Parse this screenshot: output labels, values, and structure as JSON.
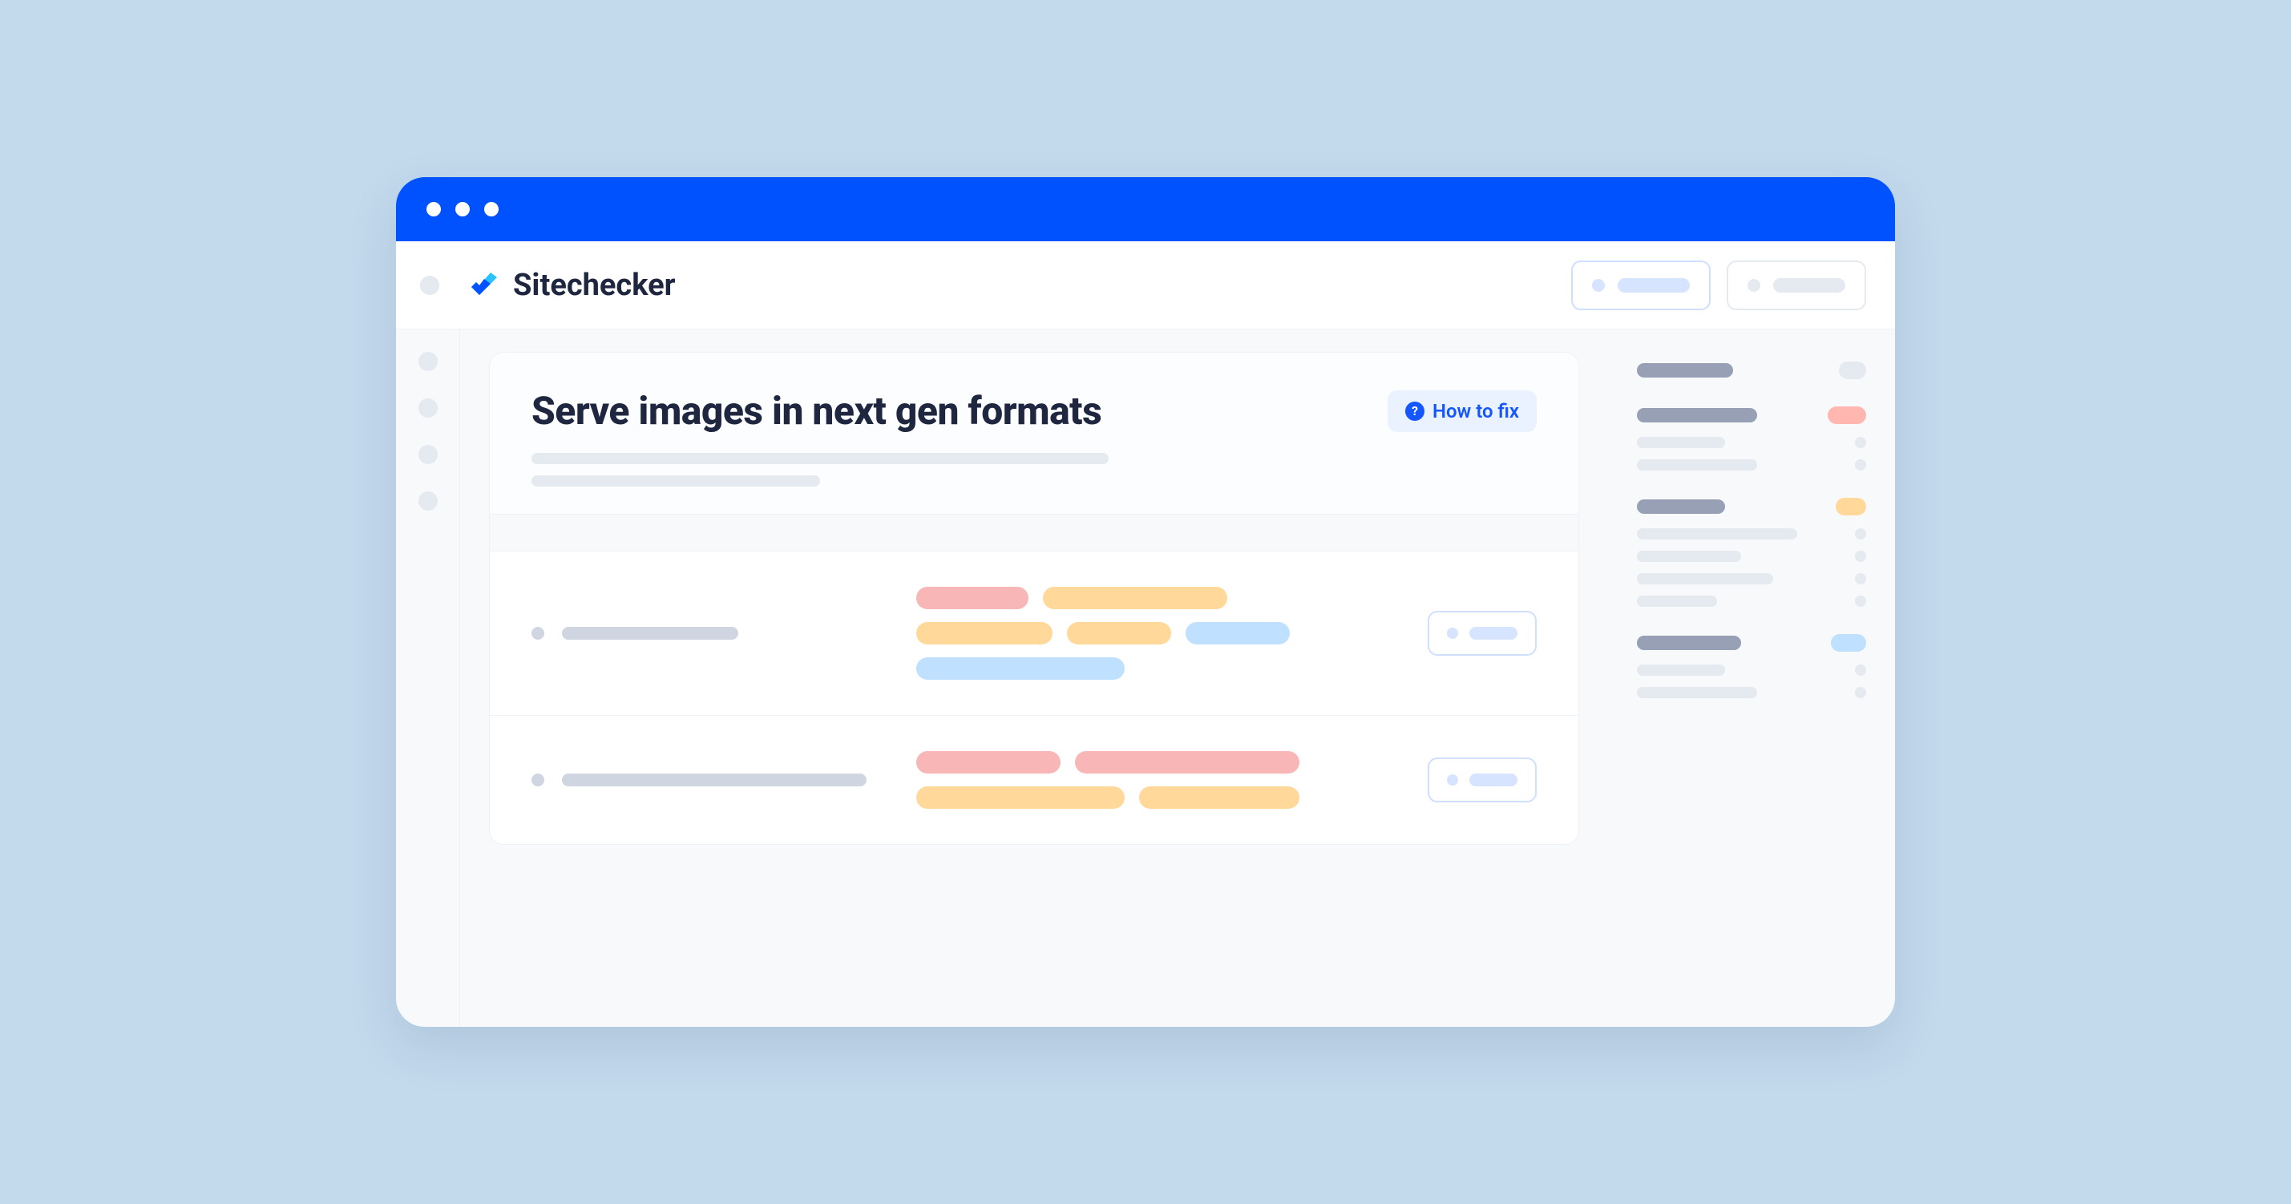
{
  "brand": "Sitechecker",
  "page_title": "Serve images in next gen formats",
  "how_to_fix_label": "How to fix"
}
